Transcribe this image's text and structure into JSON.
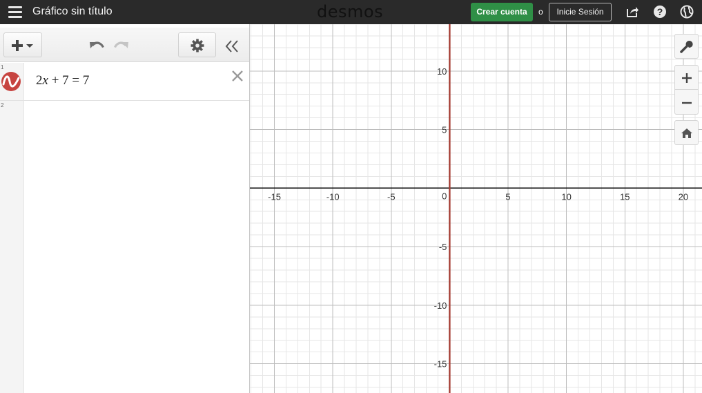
{
  "header": {
    "menu_icon": "hamburger-icon",
    "title": "Gráfico sin título",
    "logo": "desmos",
    "create_account_label": "Crear cuenta",
    "or_label": "o",
    "login_label": "Inicie Sesión",
    "icons": [
      "share-icon",
      "help-icon",
      "globe-icon"
    ]
  },
  "panel": {
    "toolbar_icons": [
      "add-icon",
      "undo-icon",
      "redo-icon",
      "gear-icon",
      "collapse-panel-icon"
    ],
    "expressions": [
      {
        "index": "1",
        "latex": "2x + 7 = 7",
        "color": "#c74440",
        "has_graph": true
      },
      {
        "index": "2",
        "latex": "",
        "has_graph": false
      }
    ]
  },
  "graph": {
    "colors": {
      "curve": "#a53d34",
      "axis": "#000000",
      "major_grid": "#bdbdbd",
      "minor_grid": "#e6e6e6"
    },
    "x_range": [
      -17.1,
      21.6
    ],
    "y_range": [
      -17.5,
      14.0
    ],
    "major_step": 5,
    "minor_step": 1,
    "x_ticks": [
      "-15",
      "-10",
      "-5",
      "0",
      "5",
      "10",
      "15",
      "20"
    ],
    "y_ticks": [
      "10",
      "5",
      "-5",
      "-10",
      "-15"
    ],
    "curve_vertical_x": 0,
    "controls": [
      "wrench-icon",
      "zoom-in-icon",
      "zoom-out-icon",
      "home-icon"
    ]
  }
}
